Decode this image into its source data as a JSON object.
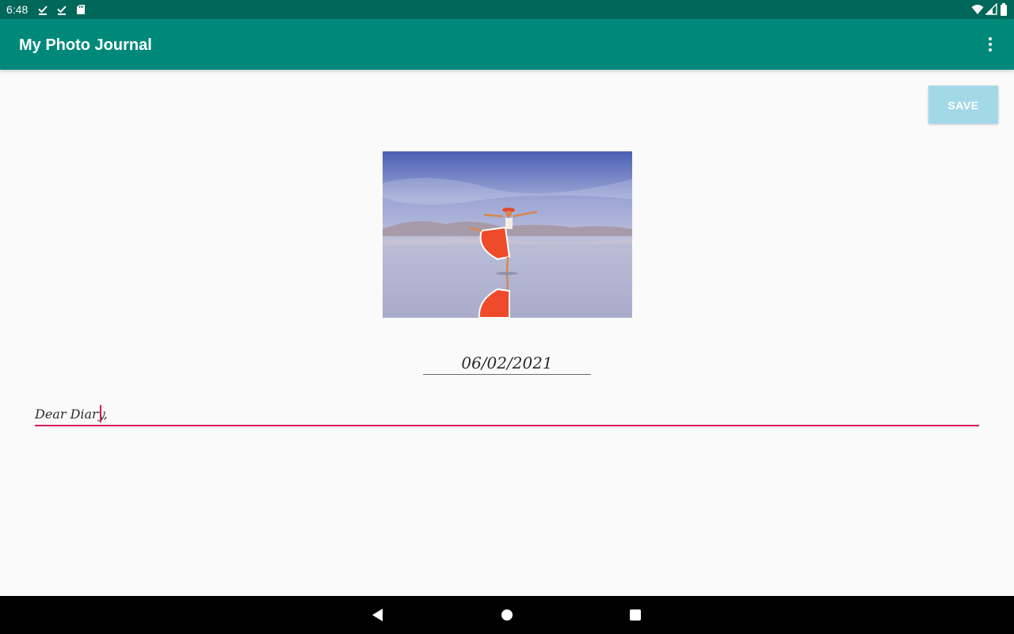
{
  "status_bar": {
    "time": "6:48",
    "left_icons": [
      "checkmark-download-icon",
      "checkmark-download-icon",
      "sd-card-icon"
    ],
    "right_icons": [
      "wifi-icon",
      "signal-icon",
      "battery-icon"
    ]
  },
  "app_bar": {
    "title": "My Photo Journal",
    "overflow_icon": "more-vertical-icon",
    "background": "#00897b",
    "status_background": "#00685a"
  },
  "content": {
    "save_label": "SAVE",
    "save_color": "#a3d8e8",
    "date_value": "06/02/2021",
    "diary_value": "Dear Diary,",
    "accent_color": "#d81b60"
  },
  "nav_bar": {
    "buttons": [
      "back-icon",
      "home-icon",
      "recents-icon"
    ]
  }
}
